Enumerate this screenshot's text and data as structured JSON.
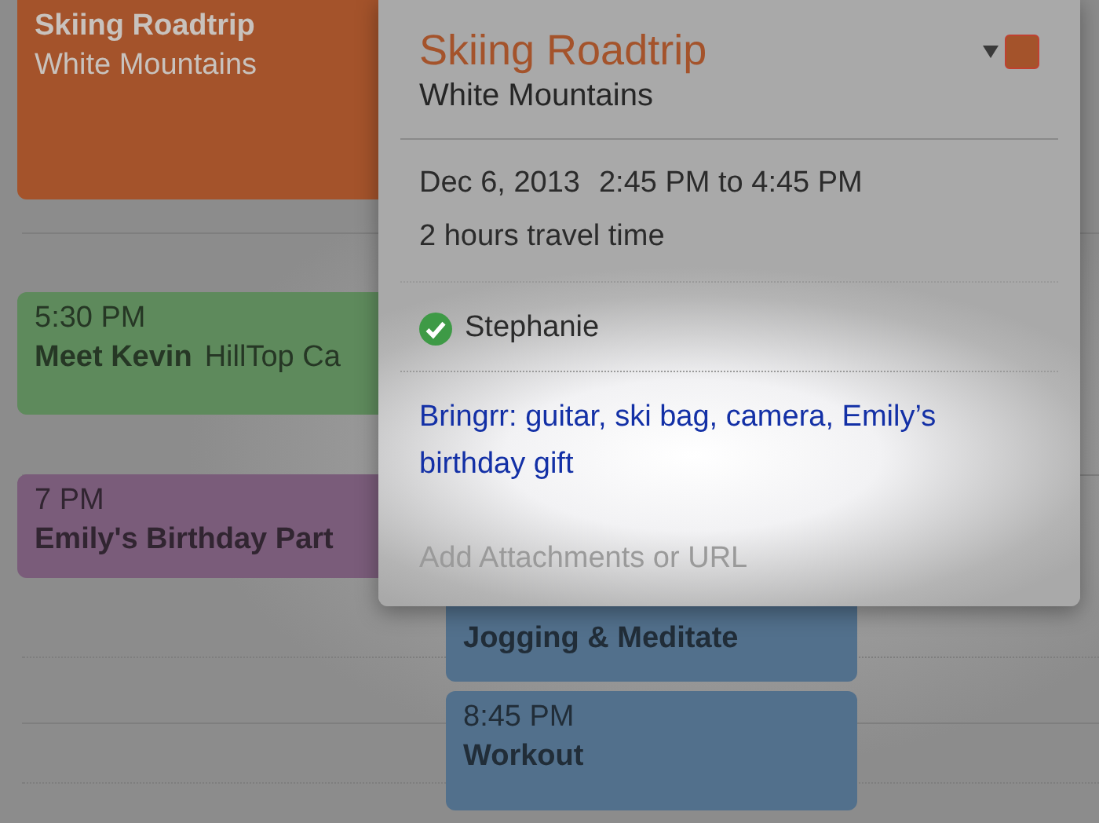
{
  "events": [
    {
      "title": "Skiing Roadtrip",
      "location": "White Mountains",
      "color": "#a4532b",
      "selected": true
    },
    {
      "time": "5:30 PM",
      "title": "Meet Kevin",
      "location": "HillTop Ca",
      "color": "#5e8a5c",
      "selected": false
    },
    {
      "time": "7 PM",
      "title": "Emily's Birthday Part",
      "color": "#7a5c7a",
      "selected": false
    },
    {
      "title": "Jogging & Meditate",
      "color": "#52708c",
      "selected": false
    },
    {
      "time": "8:45 PM",
      "title": "Workout",
      "color": "#52708c",
      "selected": false
    }
  ],
  "popover": {
    "title": "Skiing Roadtrip",
    "location": "White Mountains",
    "date": "Dec 6, 2013",
    "time_range": "2:45 PM to 4:45 PM",
    "travel_time": "2 hours travel time",
    "invitees": [
      {
        "name": "Stephanie",
        "accepted": true
      }
    ],
    "notes": "Bringrr: guitar, ski bag, camera, Emily’s birthday gift",
    "url_field": {
      "placeholder": "Add Attachments or URL"
    }
  }
}
